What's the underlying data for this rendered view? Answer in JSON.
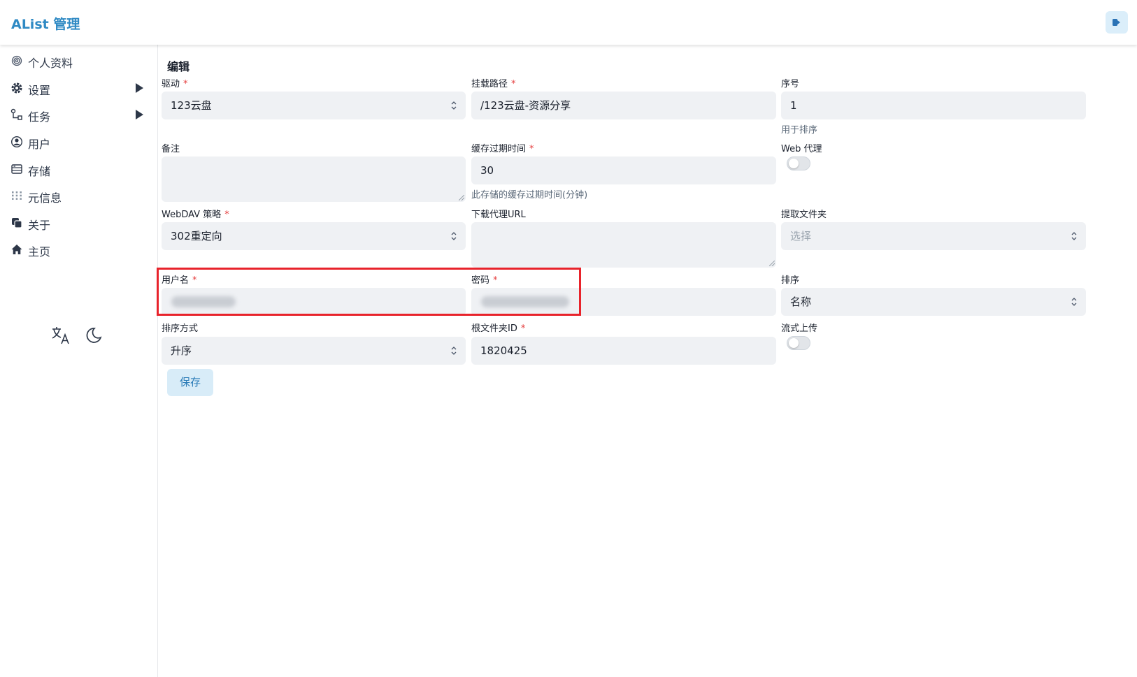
{
  "header": {
    "title": "AList 管理",
    "logout_icon": "logout-icon"
  },
  "sidebar": {
    "items": [
      {
        "label": "个人资料",
        "icon": "fingerprint-icon",
        "has_arrow": false
      },
      {
        "label": "设置",
        "icon": "gear-icon",
        "has_arrow": true
      },
      {
        "label": "任务",
        "icon": "workflow-icon",
        "has_arrow": true
      },
      {
        "label": "用户",
        "icon": "user-circle-icon",
        "has_arrow": false
      },
      {
        "label": "存储",
        "icon": "storage-icon",
        "has_arrow": false
      },
      {
        "label": "元信息",
        "icon": "metadata-icon",
        "has_arrow": false
      },
      {
        "label": "关于",
        "icon": "copy-icon",
        "has_arrow": false
      },
      {
        "label": "主页",
        "icon": "home-icon",
        "has_arrow": false
      }
    ],
    "tools": {
      "language_icon": "translate-icon",
      "theme_icon": "moon-icon"
    }
  },
  "form": {
    "title": "编辑",
    "required_mark": "*",
    "driver": {
      "label": "驱动",
      "value": "123云盘"
    },
    "mount_path": {
      "label": "挂载路径",
      "value": "/123云盘-资源分享"
    },
    "order": {
      "label": "序号",
      "value": "1",
      "help": "用于排序"
    },
    "remark": {
      "label": "备注",
      "value": ""
    },
    "cache_expiration": {
      "label": "缓存过期时间",
      "value": "30",
      "help": "此存储的缓存过期时间(分钟)"
    },
    "web_proxy": {
      "label": "Web 代理",
      "on": false
    },
    "webdav_policy": {
      "label": "WebDAV 策略",
      "value": "302重定向"
    },
    "down_proxy_url": {
      "label": "下载代理URL",
      "value": ""
    },
    "extract_folder": {
      "label": "提取文件夹",
      "placeholder": "选择"
    },
    "username": {
      "label": "用户名",
      "value_state": "blurred"
    },
    "password": {
      "label": "密码",
      "value_state": "blurred"
    },
    "order_by": {
      "label": "排序",
      "value": "名称"
    },
    "order_direction": {
      "label": "排序方式",
      "value": "升序"
    },
    "root_folder_id": {
      "label": "根文件夹ID",
      "value": "1820425"
    },
    "stream_upload": {
      "label": "流式上传",
      "on": false
    },
    "save_label": "保存"
  },
  "colors": {
    "brand": "#2f8ac4",
    "highlight": "#e8232b",
    "required": "#e53e3e",
    "field_bg": "#eff1f4"
  }
}
